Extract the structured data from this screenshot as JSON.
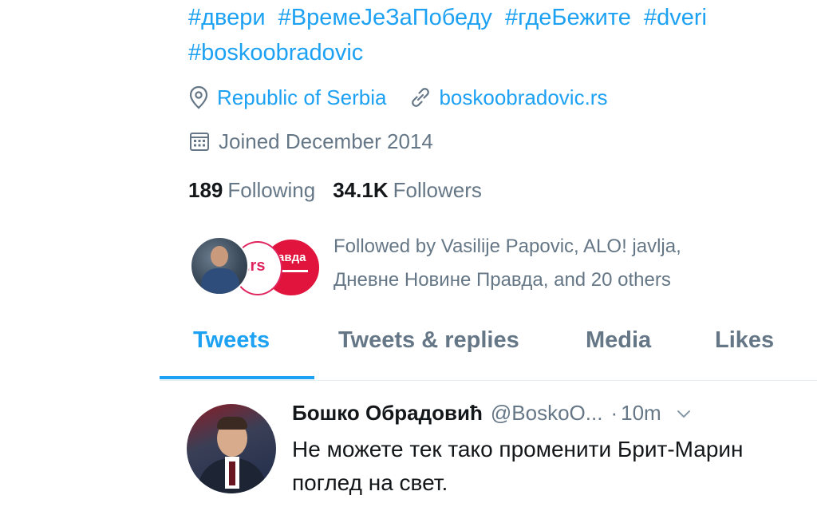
{
  "profile": {
    "hashtags": [
      "#двери",
      "#ВремеЈеЗаПобеду",
      "#гдеБежите",
      "#dveri",
      "#boskoobradovic"
    ],
    "location": "Republic of Serbia",
    "website": "boskoobradovic.rs",
    "joined": "Joined December 2014",
    "following_count": "189",
    "following_label": "Following",
    "followers_count": "34.1K",
    "followers_label": "Followers",
    "followed_by_line1": "Followed by Vasilije Papovic, ALO! javlja,",
    "followed_by_line2": "Дневне Новине Правда, and 20 others",
    "mini_avatars": {
      "second_text": ".rs",
      "third_text": "авда"
    }
  },
  "tabs": [
    {
      "label": "Tweets",
      "active": true
    },
    {
      "label": "Tweets & replies",
      "active": false
    },
    {
      "label": "Media",
      "active": false
    },
    {
      "label": "Likes",
      "active": false
    }
  ],
  "tweet": {
    "author_name": "Бошко Обрадовић",
    "handle": "@BoskoO...",
    "dot": "·",
    "time": "10m",
    "text": "Не можете тек тако променити Брит-Марин поглед на свет."
  },
  "icons": {
    "location": "location-pin-icon",
    "link": "link-icon",
    "calendar": "calendar-icon",
    "chevron": "chevron-down-icon"
  },
  "colors": {
    "accent": "#1da1f2",
    "secondary_text": "#657786",
    "primary_text": "#14171a"
  }
}
